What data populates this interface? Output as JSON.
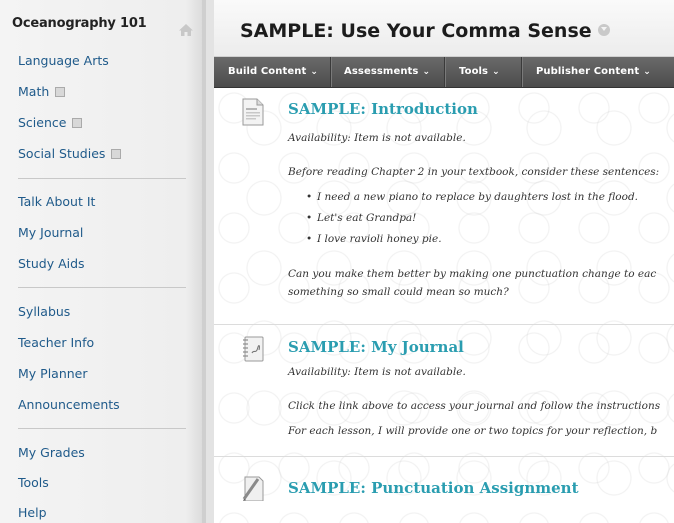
{
  "sidebar": {
    "course_title": "Oceanography 101",
    "items": [
      {
        "label": "Language Arts",
        "has_icon": false
      },
      {
        "label": "Math",
        "has_icon": true
      },
      {
        "label": "Science",
        "has_icon": true
      },
      {
        "label": "Social Studies",
        "has_icon": true
      },
      {
        "label": "Talk About It",
        "has_icon": false
      },
      {
        "label": "My Journal",
        "has_icon": false
      },
      {
        "label": "Study Aids",
        "has_icon": false
      },
      {
        "label": "Syllabus",
        "has_icon": false
      },
      {
        "label": "Teacher Info",
        "has_icon": false
      },
      {
        "label": "My Planner",
        "has_icon": false
      },
      {
        "label": "Announcements",
        "has_icon": false
      },
      {
        "label": "My Grades",
        "has_icon": false
      },
      {
        "label": "Tools",
        "has_icon": false
      },
      {
        "label": "Help",
        "has_icon": false
      }
    ]
  },
  "main": {
    "page_title": "SAMPLE: Use Your Comma Sense",
    "toolbar": [
      {
        "label": "Build Content"
      },
      {
        "label": "Assessments"
      },
      {
        "label": "Tools"
      },
      {
        "label": "Publisher Content"
      }
    ],
    "items": [
      {
        "title": "SAMPLE: Introduction",
        "availability": "Availability:  Item is not available.",
        "text1": "Before reading Chapter 2 in your textbook, consider these sentences:",
        "bullets": [
          "I need a new piano to replace by daughters lost in the flood.",
          "Let's eat Grandpa!",
          "I love ravioli honey pie."
        ],
        "text2": "Can you make them better by making one punctuation change to eac",
        "text3": "something so small could mean so much?"
      },
      {
        "title": "SAMPLE: My Journal",
        "availability": "Availability:  Item is not available.",
        "text1": "Click the link above to access your journal and follow the instructions",
        "text2": "For each lesson, I will provide one or two topics for your reflection, b"
      },
      {
        "title": "SAMPLE: Punctuation Assignment"
      }
    ]
  }
}
